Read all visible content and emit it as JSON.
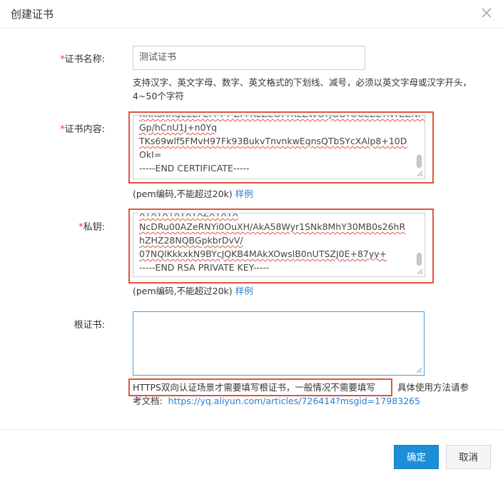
{
  "dialog": {
    "title": "创建证书",
    "close_icon": "close-icon"
  },
  "form": {
    "name": {
      "required_mark": "*",
      "label": "证书名称:",
      "value": "测试证书",
      "hint": "支持汉字、英文字母、数字、英文格式的下划线、减号，必须以英文字母或汉字开头，4~50个字符"
    },
    "cert": {
      "required_mark": "*",
      "label": "证书内容:",
      "lines": [
        "Gp/hCnU1J+n0Yq",
        "TKs69wlf5FMvH97Fk93BukvTnvnkwEqnsQTbSYcXAlp8+10D",
        "OkI=",
        "-----END CERTIFICATE-----"
      ],
      "hint_prefix": "(pem编码,不能超过20k)",
      "example_link": "样例"
    },
    "key": {
      "required_mark": "*",
      "label": "私钥:",
      "lines": [
        "NcDRu00AZeRNYi0OuXH/AkA58Wyr1SNk8MhY30MB0s26hR",
        "hZHZ28NQBGpkbrDvV/",
        "07NQlKkkxkN9BYcJQKB4MAkXOwslB0nUTSZJ0E+87yy+",
        "-----END RSA PRIVATE KEY-----"
      ],
      "hint_prefix": "(pem编码,不能超过20k)",
      "example_link": "样例"
    },
    "root": {
      "label": "根证书:",
      "value": "",
      "hint_highlight": "HTTPS双向认证场景才需要填写根证书，一般情况不需要填写",
      "hint_rest": "具体使用方法请参",
      "hint_line2_prefix": "考文档:",
      "doc_link": "https://yq.aliyun.com/articles/726414?msgid=17983265"
    }
  },
  "footer": {
    "confirm_label": "确定",
    "cancel_label": "取消"
  },
  "colors": {
    "primary": "#1d8ed8",
    "required": "#e53b2a",
    "highlight_border": "#e0553f",
    "link": "#2a7ed2",
    "root_border_focus": "#4a9fd6"
  }
}
